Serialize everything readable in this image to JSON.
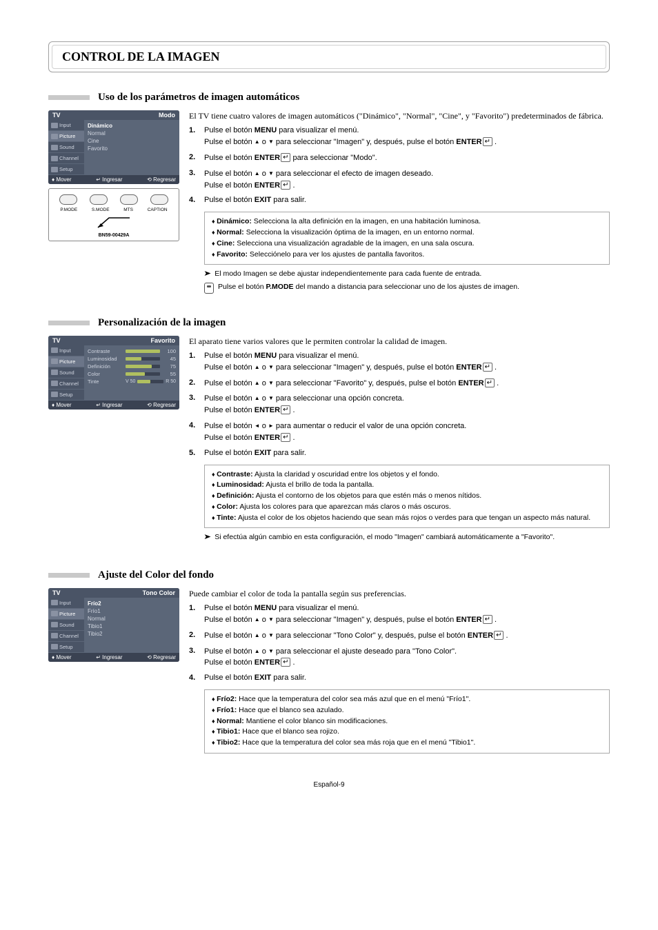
{
  "pageTitle": "CONTROL DE LA IMAGEN",
  "pageNumber": "Español-9",
  "sec1": {
    "title": "Uso de los parámetros de imagen automáticos",
    "intro": "El TV tiene cuatro valores de imagen automáticos (\"Dinámico\", \"Normal\", \"Cine\", y \"Favorito\") predeterminados de fábrica.",
    "steps": {
      "n1": "1.",
      "s1a": "Pulse el botón ",
      "s1b": " para visualizar el menú.",
      "s1c": "Pulse el botón ",
      "s1d": " o ",
      "s1e": " para seleccionar \"Imagen\" y, después, pulse el botón ",
      "n2": "2.",
      "s2a": "Pulse el botón ",
      "s2b": " para seleccionar \"Modo\".",
      "n3": "3.",
      "s3a": "Pulse el botón ",
      "s3b": " o ",
      "s3c": " para seleccionar el efecto de imagen deseado.",
      "s3d": "Pulse el botón ",
      "n4": "4.",
      "s4a": "Pulse el botón ",
      "s4b": " para salir."
    },
    "menuWord": "MENU",
    "enterWord": "ENTER",
    "exitWord": "EXIT",
    "dot": " .",
    "box": {
      "r1a": "Dinámico:",
      "r1b": " Selecciona la alta definición en la imagen, en una habitación luminosa.",
      "r2a": "Normal:",
      "r2b": " Selecciona la visualización óptima de la imagen, en un entorno normal.",
      "r3a": "Cine:",
      "r3b": " Selecciona una visualización agradable de la imagen, en una sala oscura.",
      "r4a": "Favorito:",
      "r4b": " Selecciónelo para ver los ajustes de pantalla favoritos."
    },
    "note1": "El modo Imagen se debe ajustar independientemente para cada fuente de entrada.",
    "note2a": "Pulse el botón ",
    "note2b": "P.MODE",
    "note2c": " del mando a distancia para seleccionar uno de los ajustes de imagen.",
    "tv": {
      "title": "TV",
      "subtitle": "Modo",
      "tabs": [
        "Input",
        "Picture",
        "Sound",
        "Channel",
        "Setup"
      ],
      "items": [
        "Dinámico",
        "Normal",
        "Cine",
        "Favorito"
      ],
      "foot": {
        "move": "Mover",
        "enter": "Ingresar",
        "ret": "Regresar"
      }
    },
    "remote": {
      "labels": [
        "P.MODE",
        "S.MODE",
        "MTS",
        "CAPTION"
      ],
      "model": "BN59-00429A"
    }
  },
  "sec2": {
    "title": "Personalización de la imagen",
    "intro": "El aparato tiene varios valores que le permiten controlar la calidad de imagen.",
    "steps": {
      "n1": "1.",
      "s1a": "Pulse el botón ",
      "s1b": " para visualizar el menú.",
      "s1c": "Pulse el botón ",
      "s1d": " o ",
      "s1e": " para seleccionar \"Imagen\" y, después, pulse el botón ",
      "n2": "2.",
      "s2a": "Pulse el botón ",
      "s2b": " o ",
      "s2c": " para seleccionar \"Favorito\" y, después, pulse el botón ",
      "n3": "3.",
      "s3a": "Pulse el botón ",
      "s3b": " o ",
      "s3c": " para seleccionar una opción concreta.",
      "s3d": "Pulse el botón ",
      "n4": "4.",
      "s4a": "Pulse el botón ",
      "s4b": " o ",
      "s4c": " para aumentar o reducir el valor de una opción concreta.",
      "s4d": "Pulse el botón ",
      "n5": "5.",
      "s5a": "Pulse el botón ",
      "s5b": " para salir."
    },
    "box": {
      "r1a": "Contraste:",
      "r1b": " Ajusta la claridad y oscuridad entre los objetos y el fondo.",
      "r2a": "Luminosidad:",
      "r2b": " Ajusta el brillo de toda la pantalla.",
      "r3a": "Definición:",
      "r3b": " Ajusta el contorno de los objetos para que estén más o menos nítidos.",
      "r4a": "Color:",
      "r4b": " Ajusta los colores para que aparezcan más claros o más oscuros.",
      "r5a": "Tinte:",
      "r5b": " Ajusta el color de los objetos haciendo que sean más rojos o verdes para que tengan un aspecto más natural."
    },
    "note1": "Si efectúa algún cambio en esta configuración, el modo \"Imagen\" cambiará automáticamente a \"Favorito\".",
    "tv": {
      "title": "TV",
      "subtitle": "Favorito",
      "tabs": [
        "Input",
        "Picture",
        "Sound",
        "Channel",
        "Setup"
      ],
      "sliders": [
        {
          "label": "Contraste",
          "val": "100",
          "pct": 100
        },
        {
          "label": "Luminosidad",
          "val": "45",
          "pct": 45
        },
        {
          "label": "Definición",
          "val": "75",
          "pct": 75
        },
        {
          "label": "Color",
          "val": "55",
          "pct": 55
        },
        {
          "label": "Tinte",
          "valL": "V 50",
          "valR": "R 50",
          "pct": 50
        }
      ],
      "foot": {
        "move": "Mover",
        "enter": "Ingresar",
        "ret": "Regresar"
      }
    }
  },
  "sec3": {
    "title": "Ajuste del Color del fondo",
    "intro": "Puede cambiar el color de toda la pantalla según sus preferencias.",
    "steps": {
      "n1": "1.",
      "s1a": "Pulse el botón ",
      "s1b": " para visualizar el menú.",
      "s1c": "Pulse el botón ",
      "s1d": " o ",
      "s1e": " para seleccionar \"Imagen\" y, después, pulse el botón ",
      "n2": "2.",
      "s2a": "Pulse el botón ",
      "s2b": " o ",
      "s2c": " para seleccionar \"Tono Color\" y, después, pulse el botón ",
      "n3": "3.",
      "s3a": "Pulse el botón ",
      "s3b": " o ",
      "s3c": " para seleccionar el ajuste deseado para \"Tono Color\".",
      "s3d": "Pulse el botón ",
      "n4": "4.",
      "s4a": "Pulse el botón ",
      "s4b": " para salir."
    },
    "box": {
      "r1a": "Frío2:",
      "r1b": " Hace que la temperatura del color sea más azul que en el menú \"Frío1\".",
      "r2a": "Frío1:",
      "r2b": " Hace que el blanco sea azulado.",
      "r3a": "Normal:",
      "r3b": " Mantiene el color blanco sin modificaciones.",
      "r4a": "Tibio1:",
      "r4b": " Hace que el blanco sea rojizo.",
      "r5a": "Tibio2:",
      "r5b": " Hace que la temperatura del color sea más roja que en el menú \"Tibio1\"."
    },
    "tv": {
      "title": "TV",
      "subtitle": "Tono Color",
      "tabs": [
        "Input",
        "Picture",
        "Sound",
        "Channel",
        "Setup"
      ],
      "items": [
        "Frío2",
        "Frío1",
        "Normal",
        "Tibio1",
        "Tibio2"
      ],
      "foot": {
        "move": "Mover",
        "enter": "Ingresar",
        "ret": "Regresar"
      }
    }
  }
}
